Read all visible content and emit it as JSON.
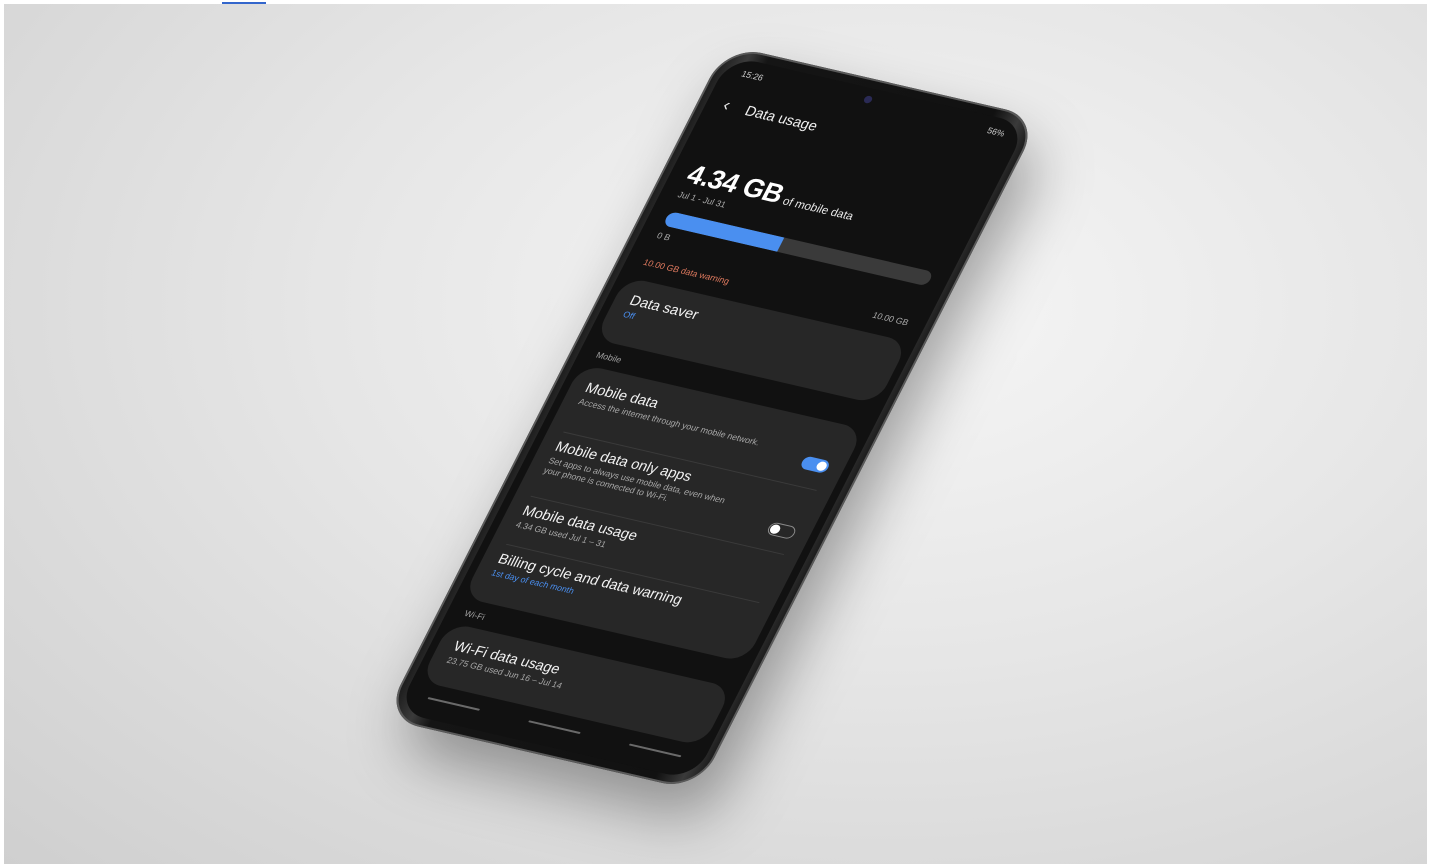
{
  "status_bar": {
    "time": "15:26",
    "right": "56%"
  },
  "header": {
    "back_icon": "chevron-left-icon",
    "title": "Data usage"
  },
  "usage": {
    "amount": "4.34 GB",
    "amount_suffix": "of mobile data",
    "range": "Jul 1 - Jul 31",
    "bar_fill_fraction": 0.434,
    "bar_min": "0 B",
    "bar_max": "10.00 GB",
    "warning": "10.00 GB data warning"
  },
  "data_saver": {
    "title": "Data saver",
    "status": "Off"
  },
  "sections": {
    "mobile": "Mobile",
    "wifi": "Wi-Fi"
  },
  "mobile_items": [
    {
      "title": "Mobile data",
      "subtitle": "Access the internet through your mobile network.",
      "toggle": true
    },
    {
      "title": "Mobile data only apps",
      "subtitle": "Set apps to always use mobile data, even when your phone is connected to Wi-Fi.",
      "toggle": false
    },
    {
      "title": "Mobile data usage",
      "subtitle": "4.34 GB used Jul 1 – 31"
    },
    {
      "title": "Billing cycle and data warning",
      "subtitle": "1st day of each month"
    }
  ],
  "wifi_items": [
    {
      "title": "Wi-Fi data usage",
      "subtitle": "23.75 GB used Jun 16 – Jul 14"
    }
  ],
  "colors": {
    "accent": "#4a8ff0",
    "warning": "#e07a5f",
    "card": "#272727",
    "screen_bg": "#111111"
  }
}
